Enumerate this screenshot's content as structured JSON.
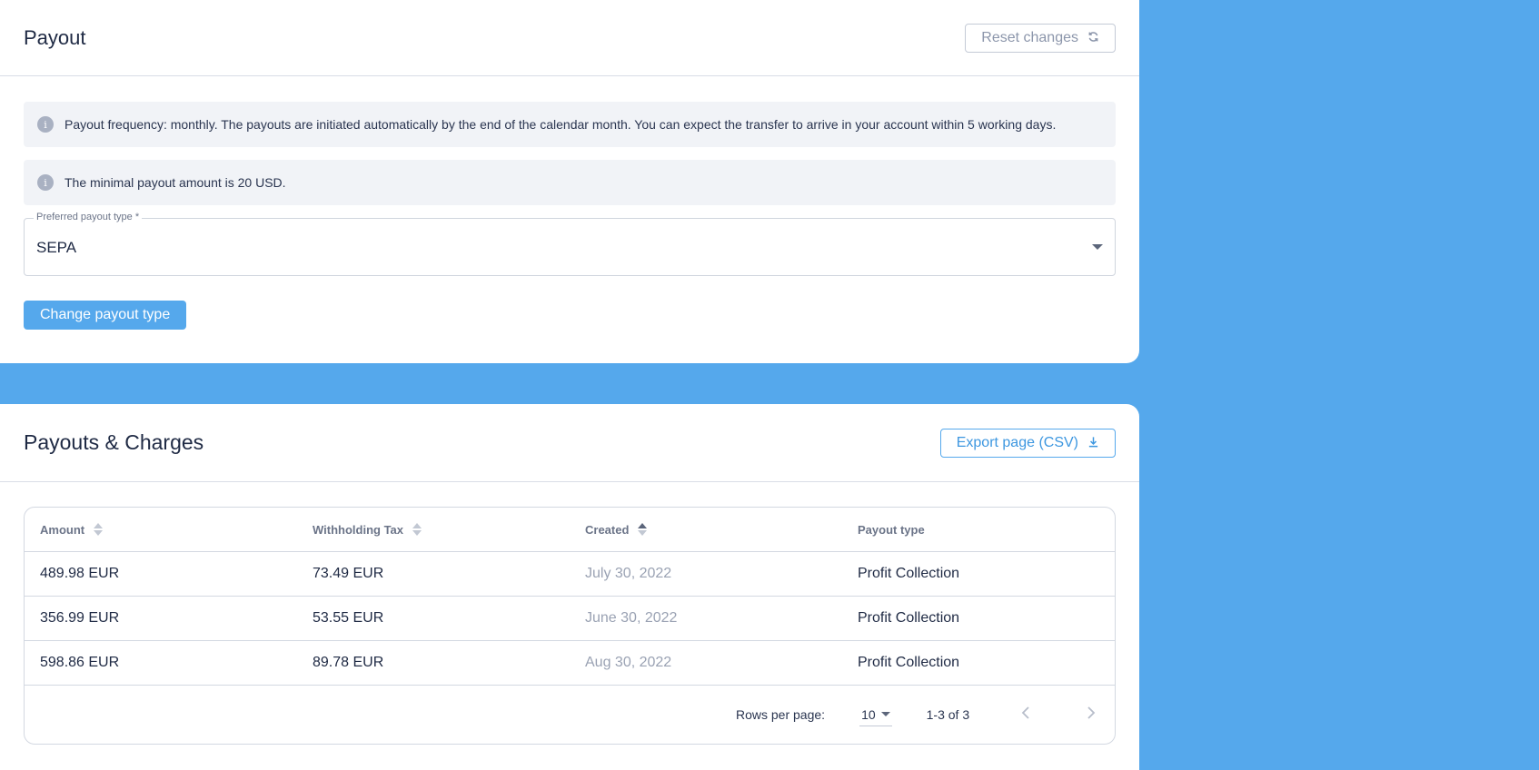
{
  "payout": {
    "title": "Payout",
    "reset_label": "Reset changes",
    "reset_icon": "refresh-icon",
    "info": [
      "Payout frequency: monthly. The payouts are initiated automatically by the end of the calendar month. You can expect the transfer to arrive in your account within 5 working days.",
      "The minimal payout amount is 20 USD."
    ],
    "info_icon_glyph": "i",
    "select": {
      "label": "Preferred payout type *",
      "value": "SEPA"
    },
    "change_label": "Change payout type"
  },
  "charges": {
    "title": "Payouts & Charges",
    "export_label": "Export page (CSV)",
    "export_icon": "download-icon",
    "columns": [
      "Amount",
      "Withholding Tax",
      "Created",
      "Payout type"
    ],
    "rows": [
      {
        "amount": "489.98 EUR",
        "tax": "73.49 EUR",
        "created": "July 30, 2022",
        "type": "Profit Collection"
      },
      {
        "amount": "356.99 EUR",
        "tax": "53.55 EUR",
        "created": "June 30, 2022",
        "type": "Profit Collection"
      },
      {
        "amount": "598.86 EUR",
        "tax": "89.78 EUR",
        "created": "Aug 30, 2022",
        "type": "Profit Collection"
      }
    ],
    "pagination": {
      "rows_per_page_label": "Rows per page:",
      "rows_per_page_value": "10",
      "range": "1-3 of 3"
    }
  },
  "colors": {
    "background": "#55a8ec",
    "accent": "#3d97e0",
    "muted_text": "#9aa2b3"
  }
}
